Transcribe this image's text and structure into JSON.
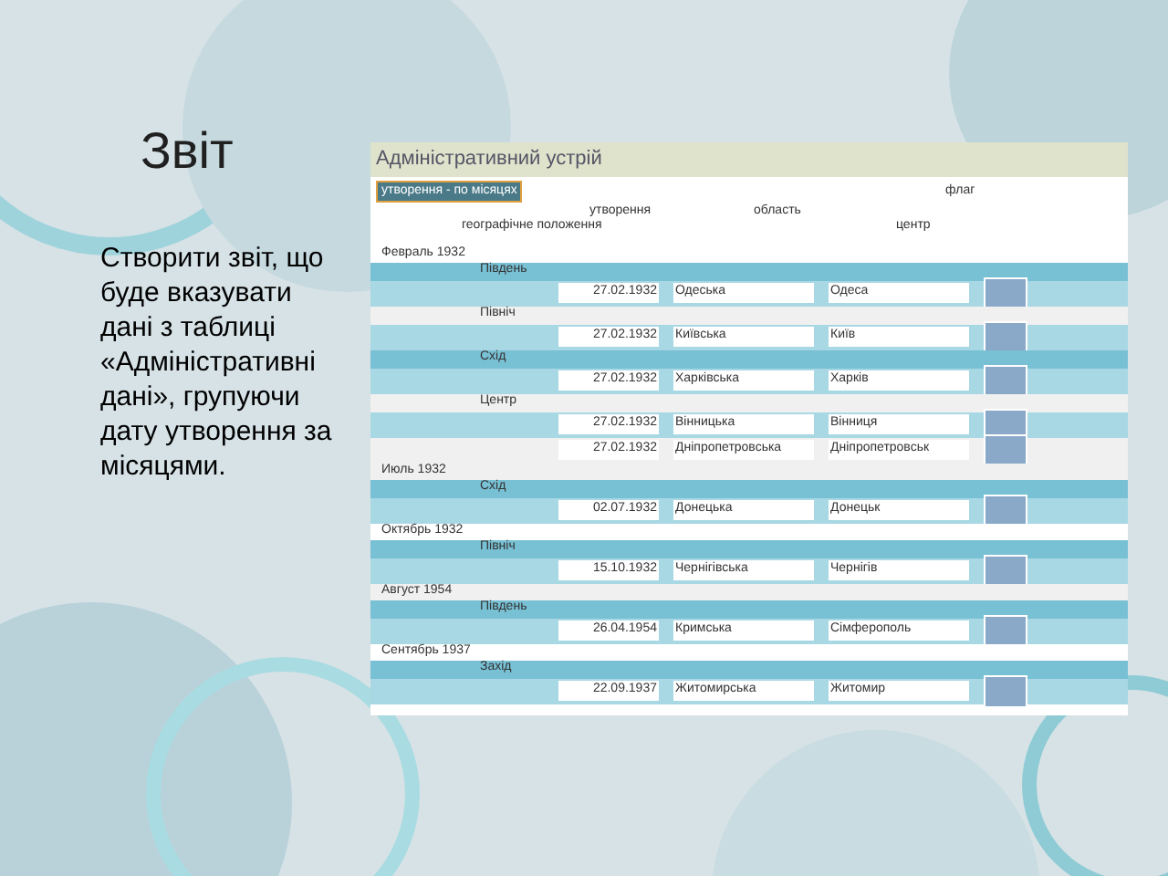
{
  "slide": {
    "title": "Звіт",
    "text": "Створити звіт, що буде вказувати дані з таблиці «Адміністративні дані», групуючи дату утворення за місяцями."
  },
  "report": {
    "title": "Адміністративний устрій",
    "group_button": "утворення - по місяцях",
    "columns": {
      "flag": "флаг",
      "formed": "утворення",
      "oblast": "область",
      "position": "географічне положення",
      "center": "центр"
    },
    "groups": [
      {
        "month": "Февраль 1932",
        "regions": [
          {
            "position": "Південь",
            "rows": [
              {
                "date": "27.02.1932",
                "oblast": "Одеська",
                "center": "Одеса"
              }
            ]
          },
          {
            "position": "Північ",
            "rows": [
              {
                "date": "27.02.1932",
                "oblast": "Київська",
                "center": "Київ"
              }
            ]
          },
          {
            "position": "Схід",
            "rows": [
              {
                "date": "27.02.1932",
                "oblast": "Харківська",
                "center": "Харків"
              }
            ]
          },
          {
            "position": "Центр",
            "rows": [
              {
                "date": "27.02.1932",
                "oblast": "Вінницька",
                "center": "Вінниця"
              },
              {
                "date": "27.02.1932",
                "oblast": "Дніпропетровська",
                "center": "Дніпропетровськ"
              }
            ]
          }
        ]
      },
      {
        "month": "Июль 1932",
        "regions": [
          {
            "position": "Схід",
            "rows": [
              {
                "date": "02.07.1932",
                "oblast": "Донецька",
                "center": "Донецьк"
              }
            ]
          }
        ]
      },
      {
        "month": "Октябрь 1932",
        "regions": [
          {
            "position": "Північ",
            "rows": [
              {
                "date": "15.10.1932",
                "oblast": "Чернігівська",
                "center": "Чернігів"
              }
            ]
          }
        ]
      },
      {
        "month": "Август 1954",
        "regions": [
          {
            "position": "Південь",
            "rows": [
              {
                "date": "26.04.1954",
                "oblast": "Кримська",
                "center": "Сімферополь"
              }
            ]
          }
        ]
      },
      {
        "month": "Сентябрь 1937",
        "regions": [
          {
            "position": "Захід",
            "rows": [
              {
                "date": "22.09.1937",
                "oblast": "Житомирська",
                "center": "Житомир"
              }
            ]
          }
        ]
      }
    ]
  }
}
